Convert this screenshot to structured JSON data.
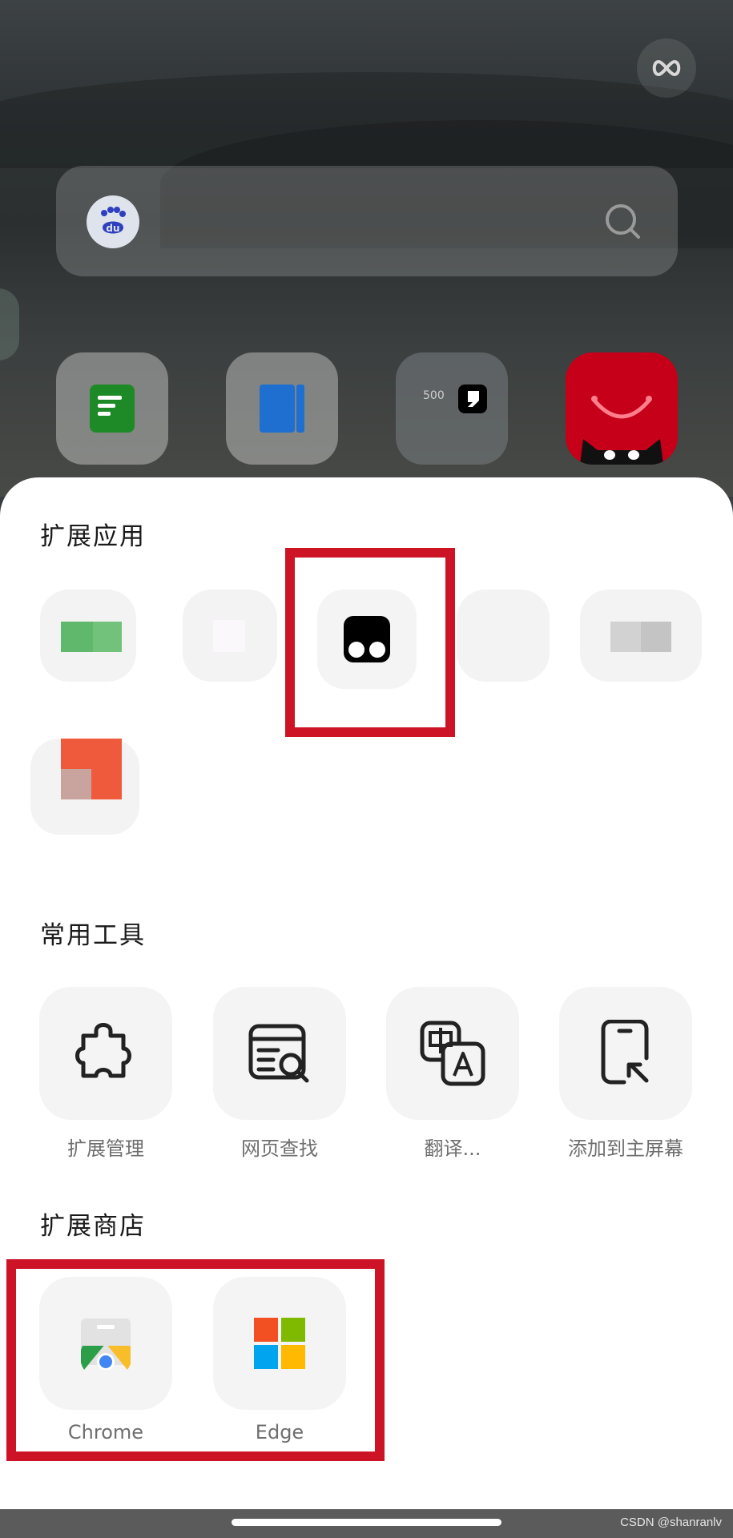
{
  "header": {
    "infinity_icon": "infinity-icon",
    "search_engine_logo": "du",
    "search_icon": "search-icon"
  },
  "home_apps": [
    {
      "name": "notes-app",
      "color": "#1e8a27"
    },
    {
      "name": "reader-app",
      "color": "#1f6fd0"
    },
    {
      "name": "500px-app",
      "label": "500",
      "color": "#000000"
    },
    {
      "name": "tmall-app",
      "color": "#c50018"
    }
  ],
  "sheet": {
    "extensions": {
      "title": "扩展应用",
      "items": [
        {
          "name": "extension-green",
          "color": "#5fb86b"
        },
        {
          "name": "extension-white",
          "color": "#ffffff"
        },
        {
          "name": "extension-tampermonkey",
          "color": "#000000"
        },
        {
          "name": "extension-blank",
          "color": "#f3f3f3"
        },
        {
          "name": "extension-gray",
          "color": "#cfcfcf"
        },
        {
          "name": "extension-orange",
          "color": "#f05a3c"
        }
      ]
    },
    "tools": {
      "title": "常用工具",
      "items": [
        {
          "label": "扩展管理",
          "icon": "puzzle-icon"
        },
        {
          "label": "网页查找",
          "icon": "find-in-page-icon"
        },
        {
          "label": "翻译...",
          "icon": "translate-icon"
        },
        {
          "label": "添加到主屏幕",
          "icon": "add-to-home-icon"
        }
      ]
    },
    "store": {
      "title": "扩展商店",
      "items": [
        {
          "label": "Chrome",
          "icon": "chrome-web-store-icon"
        },
        {
          "label": "Edge",
          "icon": "microsoft-logo-icon"
        }
      ]
    }
  },
  "highlight_color": "#cc1426",
  "watermark": "CSDN @shanranlv"
}
